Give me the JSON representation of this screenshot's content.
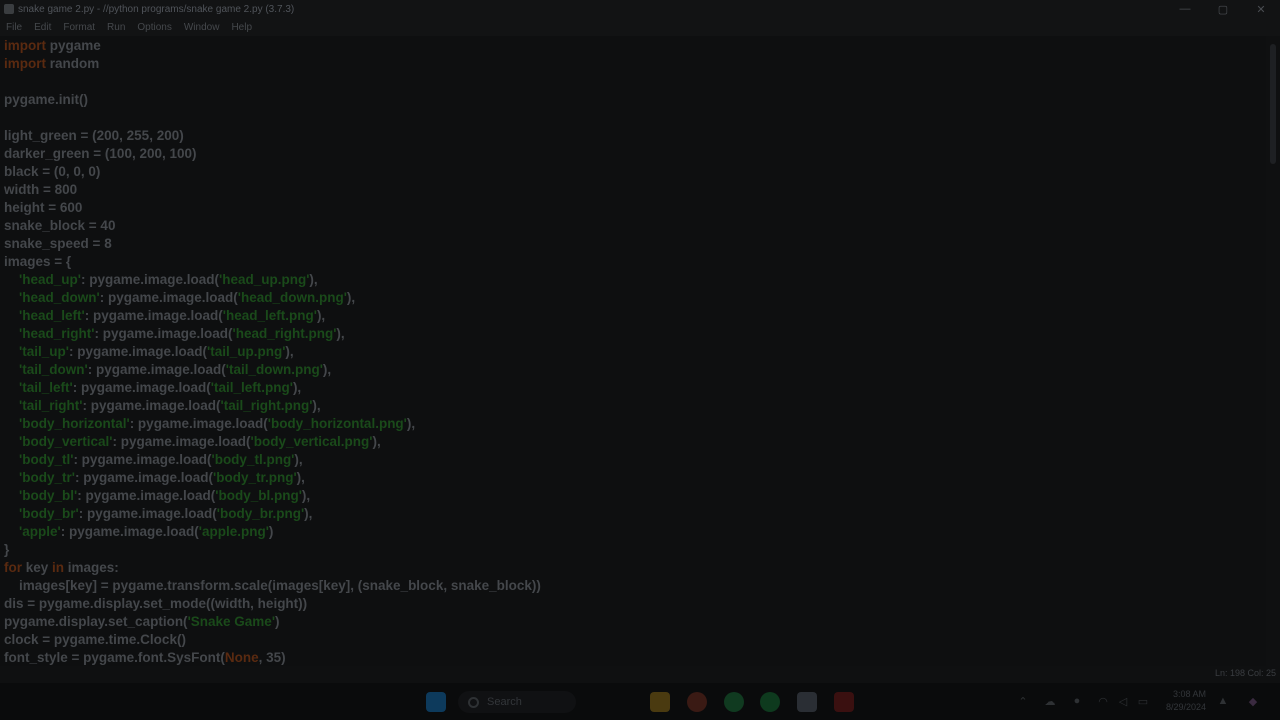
{
  "window": {
    "title": "snake game 2.py - //python programs/snake game 2.py (3.7.3)",
    "controls": {
      "minimize": "—",
      "maximize": "▢",
      "close": "✕"
    }
  },
  "menu": [
    "File",
    "Edit",
    "Format",
    "Run",
    "Options",
    "Window",
    "Help"
  ],
  "code_lines": [
    [
      {
        "t": "import",
        "c": "kw"
      },
      {
        "t": " pygame",
        "c": ""
      }
    ],
    [
      {
        "t": "import",
        "c": "kw"
      },
      {
        "t": " random",
        "c": ""
      }
    ],
    [],
    [
      {
        "t": "pygame.init()",
        "c": ""
      }
    ],
    [],
    [
      {
        "t": "light_green = (200, 255, 200)",
        "c": ""
      }
    ],
    [
      {
        "t": "darker_green = (100, 200, 100)",
        "c": ""
      }
    ],
    [
      {
        "t": "black = (0, 0, 0)",
        "c": ""
      }
    ],
    [
      {
        "t": "width = 800",
        "c": ""
      }
    ],
    [
      {
        "t": "height = 600",
        "c": ""
      }
    ],
    [
      {
        "t": "snake_block = 40",
        "c": ""
      }
    ],
    [
      {
        "t": "snake_speed = 8",
        "c": ""
      }
    ],
    [
      {
        "t": "images = {",
        "c": ""
      }
    ],
    [
      {
        "t": "    ",
        "c": ""
      },
      {
        "t": "'head_up'",
        "c": "str"
      },
      {
        "t": ": pygame.image.load(",
        "c": ""
      },
      {
        "t": "'head_up.png'",
        "c": "str"
      },
      {
        "t": "),",
        "c": ""
      }
    ],
    [
      {
        "t": "    ",
        "c": ""
      },
      {
        "t": "'head_down'",
        "c": "str"
      },
      {
        "t": ": pygame.image.load(",
        "c": ""
      },
      {
        "t": "'head_down.png'",
        "c": "str"
      },
      {
        "t": "),",
        "c": ""
      }
    ],
    [
      {
        "t": "    ",
        "c": ""
      },
      {
        "t": "'head_left'",
        "c": "str"
      },
      {
        "t": ": pygame.image.load(",
        "c": ""
      },
      {
        "t": "'head_left.png'",
        "c": "str"
      },
      {
        "t": "),",
        "c": ""
      }
    ],
    [
      {
        "t": "    ",
        "c": ""
      },
      {
        "t": "'head_right'",
        "c": "str"
      },
      {
        "t": ": pygame.image.load(",
        "c": ""
      },
      {
        "t": "'head_right.png'",
        "c": "str"
      },
      {
        "t": "),",
        "c": ""
      }
    ],
    [
      {
        "t": "    ",
        "c": ""
      },
      {
        "t": "'tail_up'",
        "c": "str"
      },
      {
        "t": ": pygame.image.load(",
        "c": ""
      },
      {
        "t": "'tail_up.png'",
        "c": "str"
      },
      {
        "t": "),",
        "c": ""
      }
    ],
    [
      {
        "t": "    ",
        "c": ""
      },
      {
        "t": "'tail_down'",
        "c": "str"
      },
      {
        "t": ": pygame.image.load(",
        "c": ""
      },
      {
        "t": "'tail_down.png'",
        "c": "str"
      },
      {
        "t": "),",
        "c": ""
      }
    ],
    [
      {
        "t": "    ",
        "c": ""
      },
      {
        "t": "'tail_left'",
        "c": "str"
      },
      {
        "t": ": pygame.image.load(",
        "c": ""
      },
      {
        "t": "'tail_left.png'",
        "c": "str"
      },
      {
        "t": "),",
        "c": ""
      }
    ],
    [
      {
        "t": "    ",
        "c": ""
      },
      {
        "t": "'tail_right'",
        "c": "str"
      },
      {
        "t": ": pygame.image.load(",
        "c": ""
      },
      {
        "t": "'tail_right.png'",
        "c": "str"
      },
      {
        "t": "),",
        "c": ""
      }
    ],
    [
      {
        "t": "    ",
        "c": ""
      },
      {
        "t": "'body_horizontal'",
        "c": "str"
      },
      {
        "t": ": pygame.image.load(",
        "c": ""
      },
      {
        "t": "'body_horizontal.png'",
        "c": "str"
      },
      {
        "t": "),",
        "c": ""
      }
    ],
    [
      {
        "t": "    ",
        "c": ""
      },
      {
        "t": "'body_vertical'",
        "c": "str"
      },
      {
        "t": ": pygame.image.load(",
        "c": ""
      },
      {
        "t": "'body_vertical.png'",
        "c": "str"
      },
      {
        "t": "),",
        "c": ""
      }
    ],
    [
      {
        "t": "    ",
        "c": ""
      },
      {
        "t": "'body_tl'",
        "c": "str"
      },
      {
        "t": ": pygame.image.load(",
        "c": ""
      },
      {
        "t": "'body_tl.png'",
        "c": "str"
      },
      {
        "t": "),",
        "c": ""
      }
    ],
    [
      {
        "t": "    ",
        "c": ""
      },
      {
        "t": "'body_tr'",
        "c": "str"
      },
      {
        "t": ": pygame.image.load(",
        "c": ""
      },
      {
        "t": "'body_tr.png'",
        "c": "str"
      },
      {
        "t": "),",
        "c": ""
      }
    ],
    [
      {
        "t": "    ",
        "c": ""
      },
      {
        "t": "'body_bl'",
        "c": "str"
      },
      {
        "t": ": pygame.image.load(",
        "c": ""
      },
      {
        "t": "'body_bl.png'",
        "c": "str"
      },
      {
        "t": "),",
        "c": ""
      }
    ],
    [
      {
        "t": "    ",
        "c": ""
      },
      {
        "t": "'body_br'",
        "c": "str"
      },
      {
        "t": ": pygame.image.load(",
        "c": ""
      },
      {
        "t": "'body_br.png'",
        "c": "str"
      },
      {
        "t": "),",
        "c": ""
      }
    ],
    [
      {
        "t": "    ",
        "c": ""
      },
      {
        "t": "'apple'",
        "c": "str"
      },
      {
        "t": ": pygame.image.load(",
        "c": ""
      },
      {
        "t": "'apple.png'",
        "c": "str"
      },
      {
        "t": ")",
        "c": ""
      }
    ],
    [
      {
        "t": "}",
        "c": ""
      }
    ],
    [
      {
        "t": "for",
        "c": "kw"
      },
      {
        "t": " key ",
        "c": ""
      },
      {
        "t": "in",
        "c": "kw"
      },
      {
        "t": " images:",
        "c": ""
      }
    ],
    [
      {
        "t": "    images[key] = pygame.transform.scale(images[key], (snake_block, snake_block))",
        "c": ""
      }
    ],
    [
      {
        "t": "dis = pygame.display.set_mode((width, height))",
        "c": ""
      }
    ],
    [
      {
        "t": "pygame.display.set_caption(",
        "c": ""
      },
      {
        "t": "'Snake Game'",
        "c": "str"
      },
      {
        "t": ")",
        "c": ""
      }
    ],
    [
      {
        "t": "clock = pygame.time.Clock()",
        "c": ""
      }
    ],
    [
      {
        "t": "font_style = pygame.font.SysFont(",
        "c": ""
      },
      {
        "t": "None",
        "c": "none"
      },
      {
        "t": ", 35)",
        "c": ""
      }
    ]
  ],
  "status": {
    "position": "Ln: 198   Col: 25"
  },
  "taskbar": {
    "search_label": "Search",
    "time": "3:08 AM",
    "date": "8/29/2024",
    "icons": [
      {
        "name": "windows-start-icon",
        "color": "#0d3a5c"
      },
      {
        "name": "file-explorer-icon",
        "color": "#4a3a10"
      },
      {
        "name": "chrome-icon",
        "color": "#3a1a14"
      },
      {
        "name": "whatsapp-icon",
        "color": "#103a20"
      },
      {
        "name": "spotify-icon",
        "color": "#0e3a1e"
      },
      {
        "name": "python-idle-icon",
        "color": "#2a2e34"
      },
      {
        "name": "recorder-icon",
        "color": "#3a1010"
      }
    ],
    "tray": [
      {
        "name": "chevron-up-icon",
        "glyph": "⌃"
      },
      {
        "name": "cloud-icon",
        "glyph": "☁"
      },
      {
        "name": "microphone-icon",
        "glyph": "●"
      },
      {
        "name": "wifi-icon",
        "glyph": "◠"
      },
      {
        "name": "volume-muted-icon",
        "glyph": "◁"
      },
      {
        "name": "battery-icon",
        "glyph": "▭"
      },
      {
        "name": "notification-bell-icon",
        "glyph": "▲"
      },
      {
        "name": "copilot-icon",
        "glyph": "◆"
      }
    ]
  }
}
